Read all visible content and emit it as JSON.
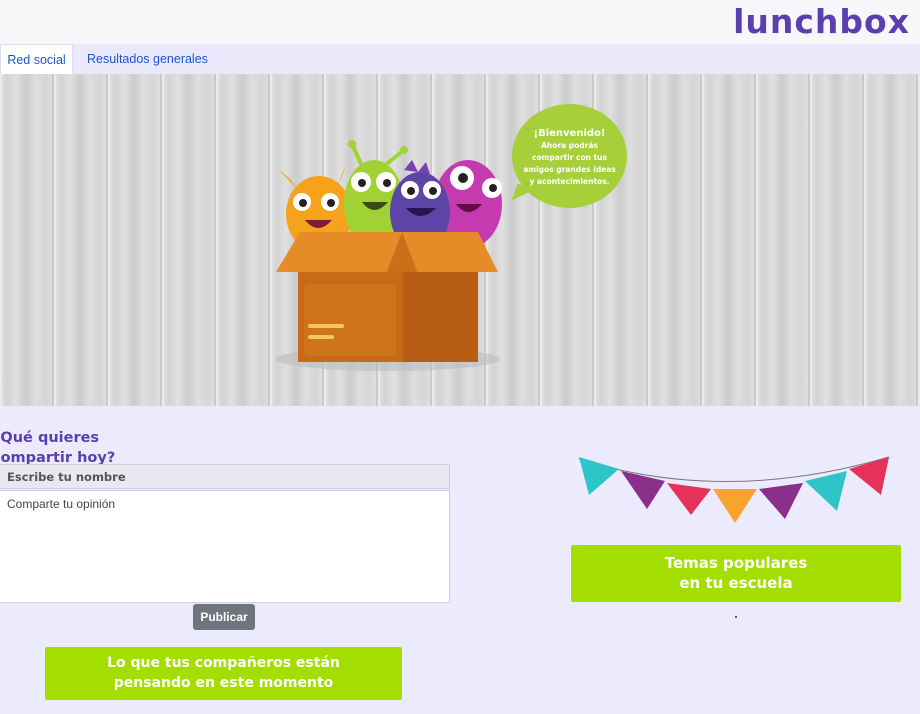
{
  "brand": {
    "logo_text": "lunchbox"
  },
  "tabs": [
    {
      "label": "Red social",
      "active": true
    },
    {
      "label": "Resultados generales",
      "active": false
    }
  ],
  "hero": {
    "bubble_title": "¡Bienvenido!",
    "bubble_text": "Ahora podrás compartir con tus amigos grandes ideas y acontecimientos."
  },
  "post_form": {
    "question": "¿Qué quieres compartir hoy?",
    "name_placeholder": "Escribe tu nombre",
    "opinion_placeholder": "Comparte tu opinión",
    "publish_label": "Publicar"
  },
  "sections": {
    "classmates_title_line1": "Lo que tus compañeros están",
    "classmates_title_line2": "pensando en este momento",
    "popular_title_line1": "Temas populares",
    "popular_title_line2": "en tu escuela"
  },
  "colors": {
    "brand_purple": "#5b3fb0",
    "accent_green": "#a4dd00",
    "page_background": "#ebebfd",
    "tab_link": "#1a56c9",
    "button_gray": "#6e757d"
  },
  "icons": [
    "monsters-in-box-illustration",
    "bunting-flags-icon"
  ]
}
